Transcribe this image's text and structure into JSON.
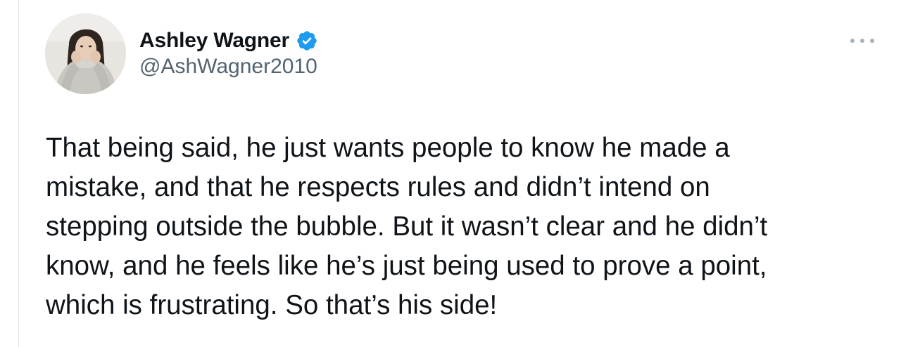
{
  "author": {
    "display_name": "Ashley Wagner",
    "handle": "@AshWagner2010",
    "verified": true,
    "verified_icon": "verified-badge-icon",
    "avatar_icon": "profile-photo"
  },
  "menu": {
    "icon": "more-options-icon"
  },
  "tweet": {
    "lines": [
      "That being said, he just wants people to know he made a",
      "mistake, and that he respects rules and didn’t intend on",
      "stepping outside the bubble. But it wasn’t clear and he didn’t",
      "know, and he feels like he’s just being used to prove a point,",
      "which is frustrating. So that’s his side!"
    ]
  },
  "colors": {
    "text": "#0f1419",
    "secondary_text": "#536471",
    "verified_blue": "#1d9bf0",
    "menu_dots": "#a7b1ba"
  }
}
